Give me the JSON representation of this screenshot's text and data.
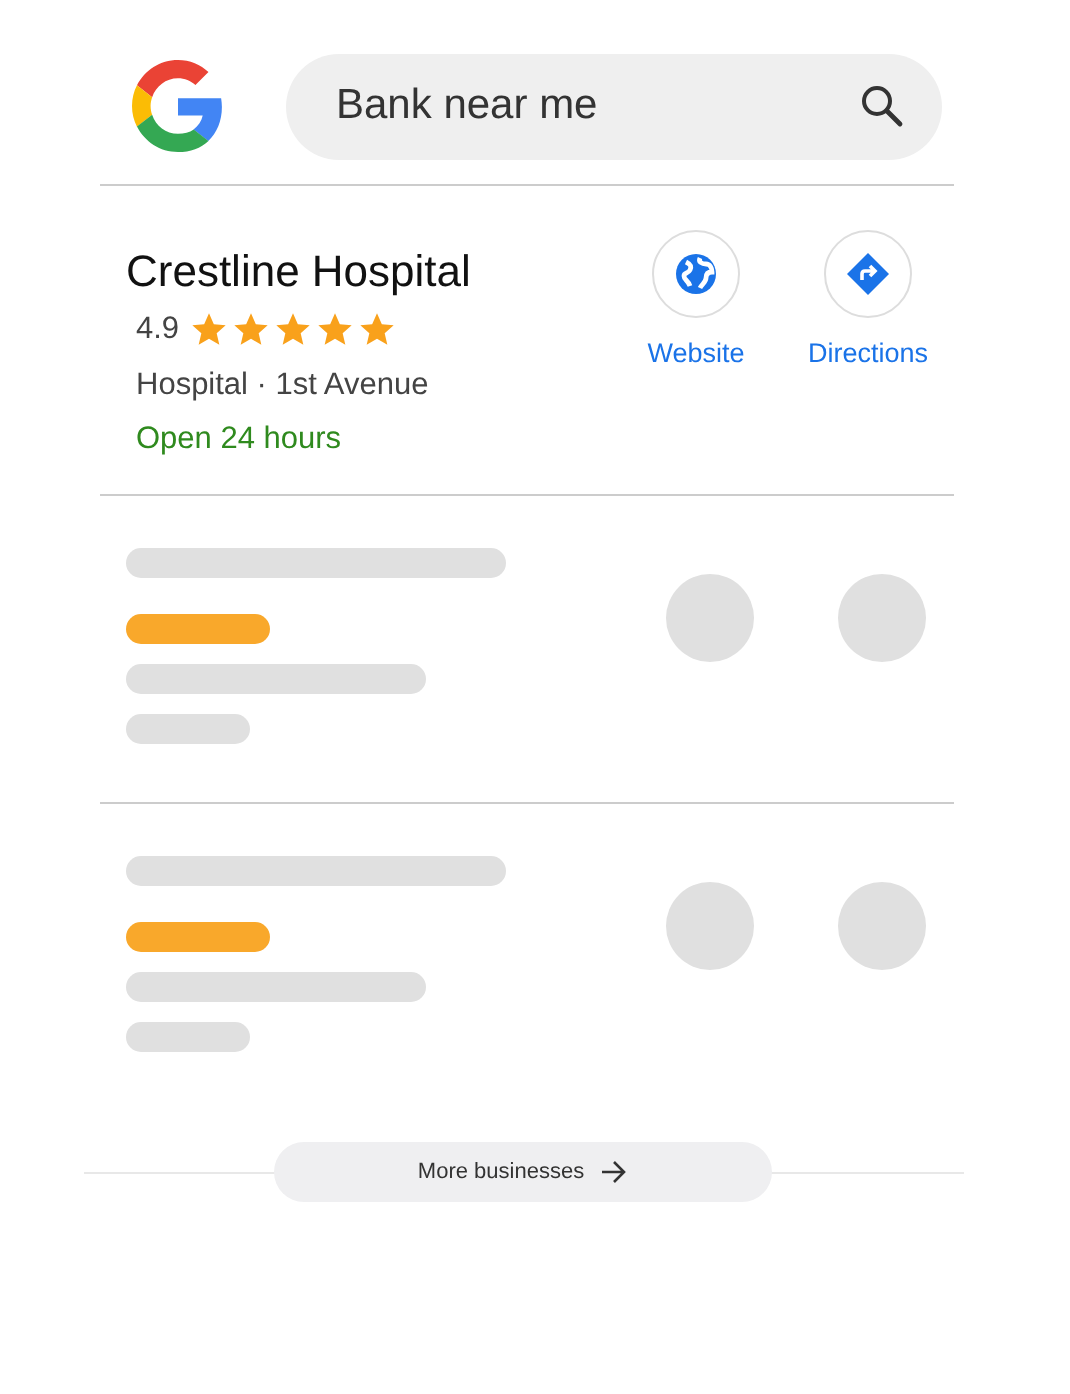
{
  "search": {
    "value": "Bank near me"
  },
  "result": {
    "name": "Crestline Hospital",
    "rating": "4.9",
    "stars": 5,
    "category": "Hospital · 1st Avenue",
    "hours": "Open 24 hours",
    "actions": [
      {
        "kind": "website",
        "label": "Website"
      },
      {
        "kind": "directions",
        "label": "Directions"
      }
    ]
  },
  "placeholders": [
    {
      "kind": "skeleton"
    },
    {
      "kind": "skeleton"
    }
  ],
  "more_button": {
    "label": "More businesses"
  }
}
